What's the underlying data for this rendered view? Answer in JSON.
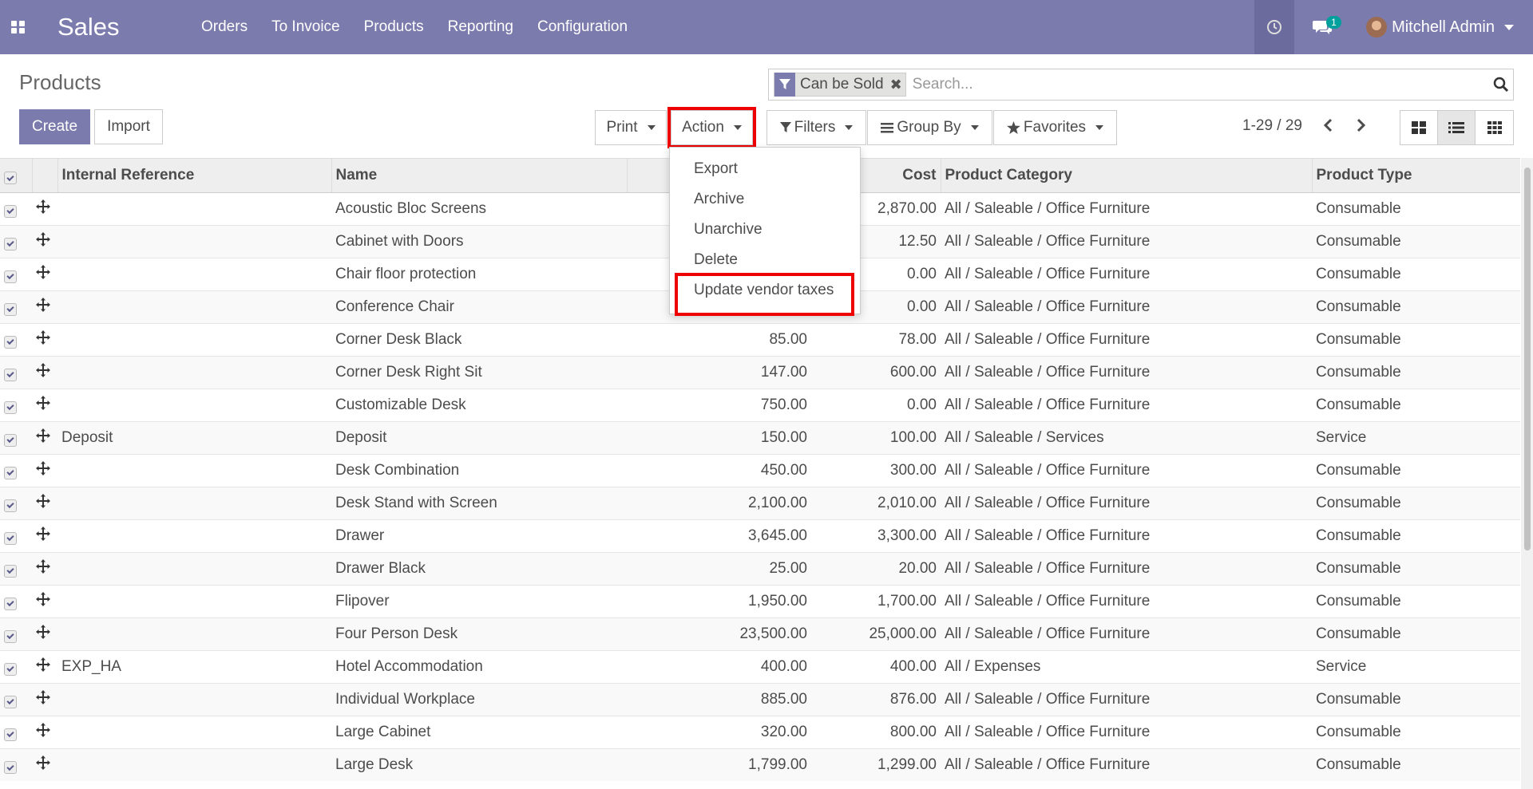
{
  "navbar": {
    "app_name": "Sales",
    "menu": [
      "Orders",
      "To Invoice",
      "Products",
      "Reporting",
      "Configuration"
    ],
    "chat_badge": "1",
    "user_name": "Mitchell Admin"
  },
  "page_title": "Products",
  "search": {
    "facet_label": "Can be Sold",
    "placeholder": "Search..."
  },
  "buttons": {
    "create": "Create",
    "import": "Import",
    "print": "Print",
    "action": "Action",
    "filters": "Filters",
    "group_by": "Group By",
    "favorites": "Favorites"
  },
  "pager": "1-29 / 29",
  "action_menu": [
    "Export",
    "Archive",
    "Unarchive",
    "Delete",
    "Update vendor taxes"
  ],
  "table": {
    "columns": [
      "Internal Reference",
      "Name",
      "",
      "Cost",
      "Product Category",
      "Product Type"
    ],
    "rows": [
      {
        "ref": "",
        "name": "Acoustic Bloc Screens",
        "price": "",
        "cost": "2,870.00",
        "category": "All / Saleable / Office Furniture",
        "type": "Consumable"
      },
      {
        "ref": "",
        "name": "Cabinet with Doors",
        "price": "",
        "cost": "12.50",
        "category": "All / Saleable / Office Furniture",
        "type": "Consumable"
      },
      {
        "ref": "",
        "name": "Chair floor protection",
        "price": "",
        "cost": "0.00",
        "category": "All / Saleable / Office Furniture",
        "type": "Consumable"
      },
      {
        "ref": "",
        "name": "Conference Chair",
        "price": "",
        "cost": "0.00",
        "category": "All / Saleable / Office Furniture",
        "type": "Consumable"
      },
      {
        "ref": "",
        "name": "Corner Desk Black",
        "price": "85.00",
        "cost": "78.00",
        "category": "All / Saleable / Office Furniture",
        "type": "Consumable"
      },
      {
        "ref": "",
        "name": "Corner Desk Right Sit",
        "price": "147.00",
        "cost": "600.00",
        "category": "All / Saleable / Office Furniture",
        "type": "Consumable"
      },
      {
        "ref": "",
        "name": "Customizable Desk",
        "price": "750.00",
        "cost": "0.00",
        "category": "All / Saleable / Office Furniture",
        "type": "Consumable"
      },
      {
        "ref": "Deposit",
        "name": "Deposit",
        "price": "150.00",
        "cost": "100.00",
        "category": "All / Saleable / Services",
        "type": "Service"
      },
      {
        "ref": "",
        "name": "Desk Combination",
        "price": "450.00",
        "cost": "300.00",
        "category": "All / Saleable / Office Furniture",
        "type": "Consumable"
      },
      {
        "ref": "",
        "name": "Desk Stand with Screen",
        "price": "2,100.00",
        "cost": "2,010.00",
        "category": "All / Saleable / Office Furniture",
        "type": "Consumable"
      },
      {
        "ref": "",
        "name": "Drawer",
        "price": "3,645.00",
        "cost": "3,300.00",
        "category": "All / Saleable / Office Furniture",
        "type": "Consumable"
      },
      {
        "ref": "",
        "name": "Drawer Black",
        "price": "25.00",
        "cost": "20.00",
        "category": "All / Saleable / Office Furniture",
        "type": "Consumable"
      },
      {
        "ref": "",
        "name": "Flipover",
        "price": "1,950.00",
        "cost": "1,700.00",
        "category": "All / Saleable / Office Furniture",
        "type": "Consumable"
      },
      {
        "ref": "",
        "name": "Four Person Desk",
        "price": "23,500.00",
        "cost": "25,000.00",
        "category": "All / Saleable / Office Furniture",
        "type": "Consumable"
      },
      {
        "ref": "EXP_HA",
        "name": "Hotel Accommodation",
        "price": "400.00",
        "cost": "400.00",
        "category": "All / Expenses",
        "type": "Service"
      },
      {
        "ref": "",
        "name": "Individual Workplace",
        "price": "885.00",
        "cost": "876.00",
        "category": "All / Saleable / Office Furniture",
        "type": "Consumable"
      },
      {
        "ref": "",
        "name": "Large Cabinet",
        "price": "320.00",
        "cost": "800.00",
        "category": "All / Saleable / Office Furniture",
        "type": "Consumable"
      },
      {
        "ref": "",
        "name": "Large Desk",
        "price": "1,799.00",
        "cost": "1,299.00",
        "category": "All / Saleable / Office Furniture",
        "type": "Consumable"
      }
    ]
  },
  "colors": {
    "brand": "#7c7bad",
    "highlight": "#ee0000",
    "badge": "#00a09d"
  }
}
